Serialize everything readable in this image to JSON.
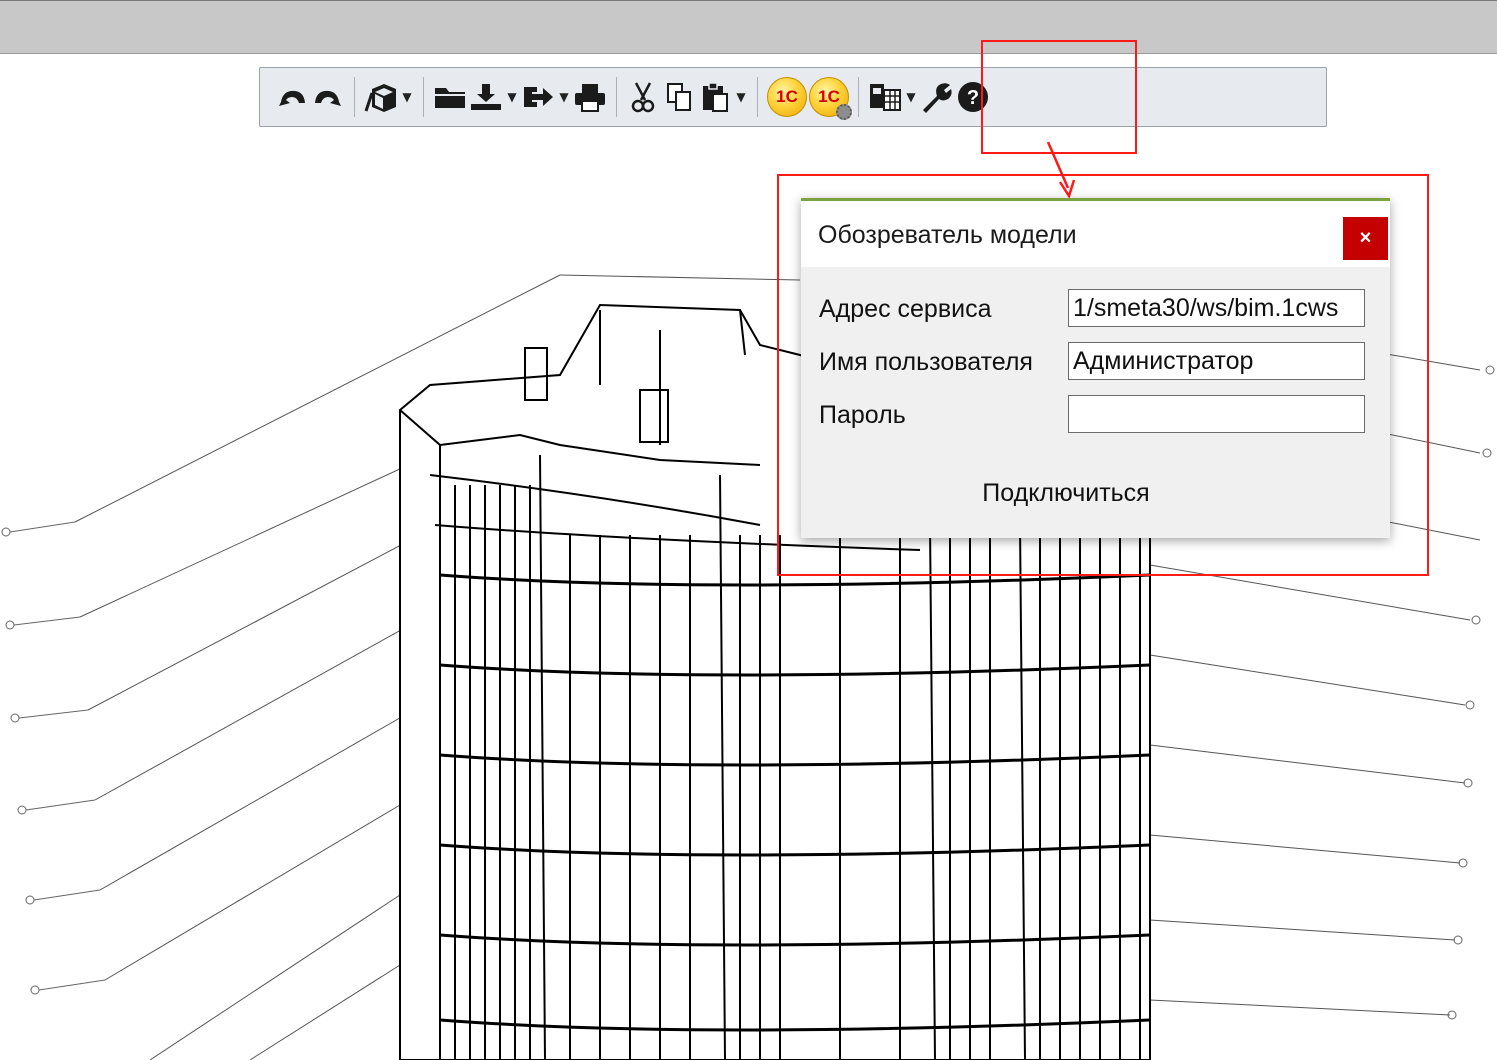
{
  "toolbar": {
    "items": [
      {
        "name": "undo-button",
        "icon": "undo-icon"
      },
      {
        "name": "redo-button",
        "icon": "redo-icon"
      },
      {
        "name": "view-cube-button",
        "icon": "view-cube-icon"
      },
      {
        "name": "open-button",
        "icon": "folder-icon"
      },
      {
        "name": "import-button",
        "icon": "download-icon"
      },
      {
        "name": "export-button",
        "icon": "export-arrow-icon"
      },
      {
        "name": "print-button",
        "icon": "printer-icon"
      },
      {
        "name": "cut-button",
        "icon": "scissors-icon"
      },
      {
        "name": "copy-button",
        "icon": "copy-icon"
      },
      {
        "name": "paste-button",
        "icon": "clipboard-icon"
      },
      {
        "name": "1c-connect-button",
        "icon": "1c-logo-icon"
      },
      {
        "name": "1c-settings-button",
        "icon": "1c-settings-icon"
      },
      {
        "name": "layout-button",
        "icon": "grid-layout-icon"
      },
      {
        "name": "tools-button",
        "icon": "wrench-icon"
      },
      {
        "name": "help-button",
        "icon": "help-icon"
      }
    ],
    "logo_text": "1С"
  },
  "dialog": {
    "title": "Обозреватель модели",
    "close_label": "×",
    "service_address_label": "Адрес сервиса",
    "service_address_value": "1/smeta30/ws/bim.1cws",
    "username_label": "Имя пользователя",
    "username_value": "Администратор",
    "password_label": "Пароль",
    "password_value": "",
    "connect_label": "Подключиться"
  },
  "colors": {
    "annotation": "#ff1a1a",
    "close_button": "#c40000",
    "dialog_accent": "#7ba23f",
    "toolbar_bg": "#e7eaef"
  }
}
